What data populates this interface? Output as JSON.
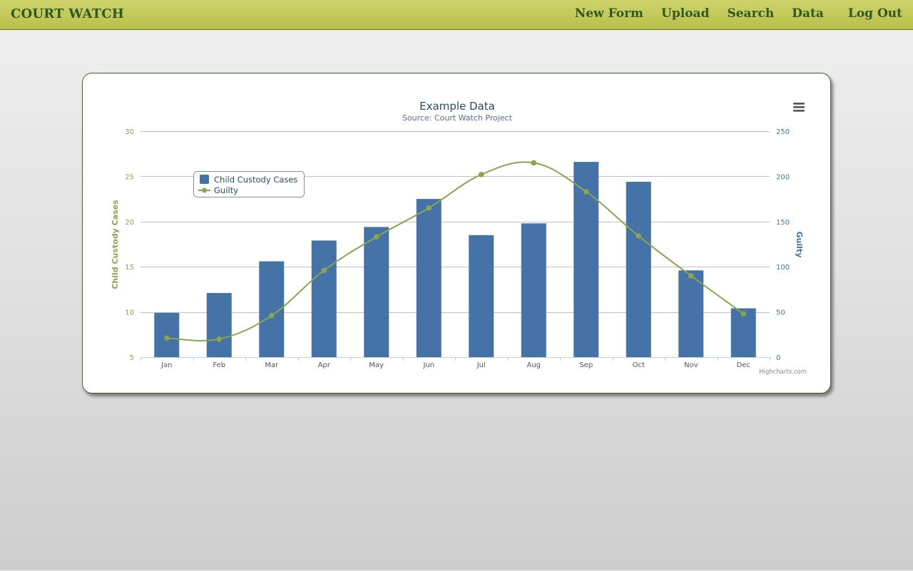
{
  "app": {
    "brand": "COURT WATCH"
  },
  "nav": [
    {
      "label": "New Form"
    },
    {
      "label": "Upload"
    },
    {
      "label": "Search"
    },
    {
      "label": "Data"
    },
    {
      "label": "Log Out"
    }
  ],
  "menu_icon": "hamburger-menu-icon",
  "credits": "Highcharts.com",
  "colors": {
    "bar": "#4572a7",
    "line": "#89a54e",
    "nav_bar": "#c2c95a",
    "brand_text": "#2f5a1d"
  },
  "chart_data": {
    "type": "bar",
    "title": "Example Data",
    "subtitle": "Source: Court Watch Project",
    "categories": [
      "Jan",
      "Feb",
      "Mar",
      "Apr",
      "May",
      "Jun",
      "Jul",
      "Aug",
      "Sep",
      "Oct",
      "Nov",
      "Dec"
    ],
    "series": [
      {
        "name": "Child Custody Cases",
        "type": "column",
        "axis": "left",
        "values": [
          9.9,
          12.1,
          15.6,
          17.9,
          19.4,
          22.5,
          18.5,
          19.8,
          26.6,
          24.4,
          14.6,
          10.4
        ]
      },
      {
        "name": "Guilty",
        "type": "spline",
        "axis": "right",
        "values": [
          21,
          20,
          46,
          96,
          133,
          165,
          202,
          215,
          183,
          134,
          90,
          48
        ]
      }
    ],
    "ylabel_left": "Child Custody Cases",
    "ylim_left": [
      5,
      30
    ],
    "yticks_left": [
      5,
      10,
      15,
      20,
      25,
      30
    ],
    "ylabel_right": "Guilty",
    "ylim_right": [
      0,
      250
    ],
    "yticks_right": [
      0,
      50,
      100,
      150,
      200,
      250
    ],
    "grid": true,
    "legend_position": "top-left"
  }
}
